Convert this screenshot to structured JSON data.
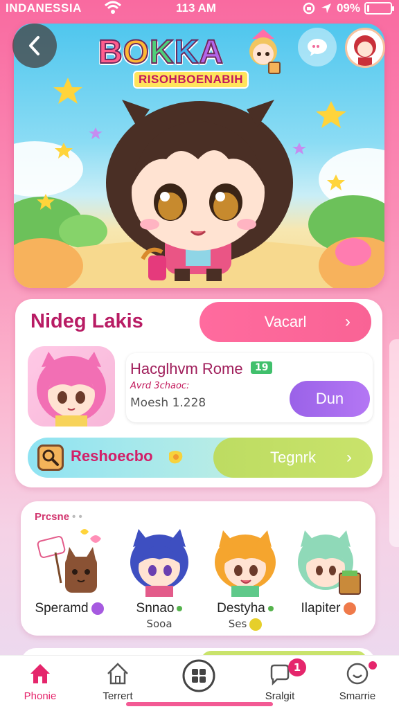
{
  "status_bar": {
    "carrier": "INDANESSIA",
    "time": "113 AM",
    "battery": "09%",
    "battery_level": 0.09
  },
  "hero": {
    "logo_title": "BOKKA",
    "logo_subtitle": "RISOHBOENABIH",
    "icons": [
      "back-arrow-icon",
      "chat-bubble-icon",
      "profile-avatar"
    ]
  },
  "main": {
    "title": "Nideg Lakis",
    "vaccari_button": "Vacarl",
    "entry": {
      "name": "Hacglhvm Rome",
      "badge": "19",
      "subtitle": "Avrd 3chaoc:",
      "meta": "Moesh 1.228"
    },
    "join_button": "Dun",
    "strip_label": "Reshoecbo",
    "tegnrk_button": "Tegnrk"
  },
  "community": {
    "label": "Prcsne",
    "characters": [
      {
        "name": "Speramd",
        "sub": "",
        "badge_color": "#a65ae0"
      },
      {
        "name": "Snnao",
        "sub": "Sooa",
        "badge_color": "#55b34c"
      },
      {
        "name": "Destyha",
        "sub": "Ses",
        "badge_color": "#e6cf2a"
      },
      {
        "name": "Ilapiter",
        "sub": "",
        "badge_color": "#ef7a4a"
      }
    ]
  },
  "nav": {
    "items": [
      {
        "label": "Phonie",
        "icon": "home-icon",
        "active": true
      },
      {
        "label": "Terrert",
        "icon": "house-outline-icon",
        "active": false
      },
      {
        "label": "",
        "icon": "grid-icon",
        "active": false
      },
      {
        "label": "Sralgit",
        "icon": "chat-icon",
        "badge": "1"
      },
      {
        "label": "Smarrie",
        "icon": "bubble-icon",
        "dot": true
      }
    ]
  },
  "colors": {
    "accent_pink": "#e5266c",
    "purple": "#a65ae0",
    "lime": "#c9e36b"
  }
}
